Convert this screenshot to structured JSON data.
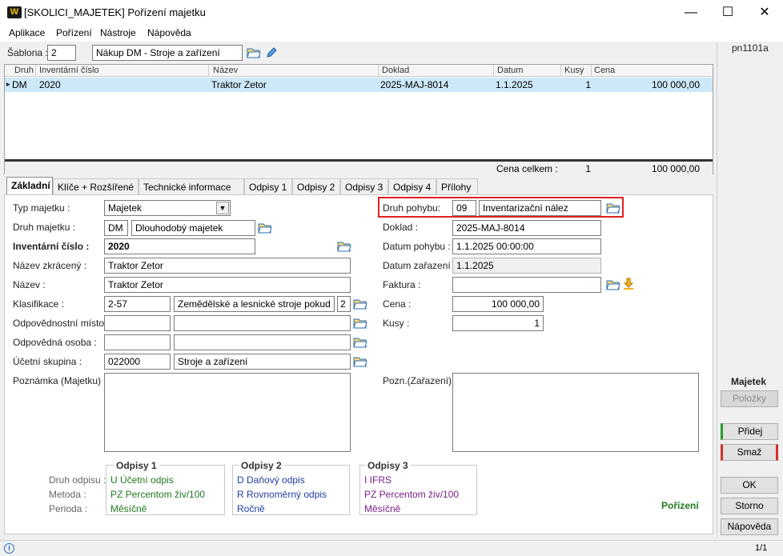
{
  "window": {
    "title": "[SKOLICI_MAJETEK] Pořízení majetku",
    "logo": "W",
    "minimize": "—",
    "maximize": "☐",
    "close": "✕"
  },
  "menu": [
    "Aplikace",
    "Pořízení",
    "Nástroje",
    "Nápověda"
  ],
  "template": {
    "label": "Šablona :",
    "code": "2",
    "name": "Nákup DM - Stroje a zařízení"
  },
  "grid": {
    "columns": [
      "Druh",
      "Inventární číslo",
      "Název",
      "Doklad",
      "Datum",
      "Kusy",
      "Cena"
    ],
    "rows": [
      {
        "marker": "▸",
        "druh": "DM",
        "inv": "2020",
        "nazev": "Traktor Zetor",
        "doklad": "2025-MAJ-8014",
        "datum": "1.1.2025",
        "kusy": "1",
        "cena": "100 000,00"
      }
    ],
    "footer": {
      "label": "Cena celkem :",
      "kusy": "1",
      "cena": "100 000,00"
    }
  },
  "tabs": [
    "Základní",
    "Klíče + Rozšířené",
    "Technické informace",
    "Odpisy 1",
    "Odpisy 2",
    "Odpisy 3",
    "Odpisy 4",
    "Přílohy"
  ],
  "form": {
    "typ_label": "Typ majetku :",
    "typ_value": "Majetek",
    "druh_label": "Druh majetku :",
    "druh_code": "DM",
    "druh_name": "Dlouhodobý majetek",
    "inv_label": "Inventární číslo :",
    "inv_value": "2020",
    "nazev_zkr_label": "Název zkrácený :",
    "nazev_zkr_value": "Traktor Zetor",
    "nazev_label": "Název :",
    "nazev_value": "Traktor Zetor",
    "klas_label": "Klasifikace :",
    "klas_code": "2-57",
    "klas_name": "Zemědělské a lesnické stroje pokud n",
    "klas_num": "2",
    "odp_misto_label": "Odpovědnostní místo :",
    "odp_osoba_label": "Odpovědná osoba :",
    "ucetni_label": "Účetní skupina :",
    "ucetni_code": "022000",
    "ucetni_name": "Stroje a zařízení",
    "pozn_label": "Poznámka (Majetku) :",
    "pohyb_label": "Druh pohybu:",
    "pohyb_code": "09",
    "pohyb_name": "Inventarizační nález",
    "doklad_label": "Doklad :",
    "doklad_value": "2025-MAJ-8014",
    "datum_pohybu_label": "Datum pohybu :",
    "datum_pohybu_value": "1.1.2025 00:00:00",
    "datum_zar_label": "Datum zařazení :",
    "datum_zar_value": "1.1.2025",
    "faktura_label": "Faktura :",
    "cena_label": "Cena :",
    "cena_value": "100 000,00",
    "kusy_label": "Kusy :",
    "kusy_value": "1",
    "pozn_zar_label": "Pozn.(Zařazení) :"
  },
  "odpisy": {
    "row_labels": [
      "Druh odpisu :",
      "Metoda :",
      "Perioda :"
    ],
    "boxes": [
      {
        "title": "Odpisy 1",
        "lines": [
          "U  Účetní odpis",
          "PZ  Percentom živ/100",
          "Měsíčně"
        ],
        "color": "#1f7a1f"
      },
      {
        "title": "Odpisy 2",
        "lines": [
          "D  Daňový odpis",
          "R  Rovnoměrný odpis",
          "Ročně"
        ],
        "color": "#1f3fa0"
      },
      {
        "title": "Odpisy 3",
        "lines": [
          "I  IFRS",
          "PZ  Percentom živ/100",
          "Měsíčně"
        ],
        "color": "#7a1f8a"
      }
    ],
    "status": "Pořízení"
  },
  "side": {
    "code": "pn1101a",
    "section": "Majetek",
    "polozky": "Položky",
    "pridej": "Přidej",
    "smaz": "Smaž",
    "ok": "OK",
    "storno": "Storno",
    "napoveda": "Nápověda"
  },
  "status": {
    "page": "1/1",
    "info_icon": "i"
  },
  "colors": {
    "highlight": "#e02020",
    "selection": "#cde8f7"
  }
}
